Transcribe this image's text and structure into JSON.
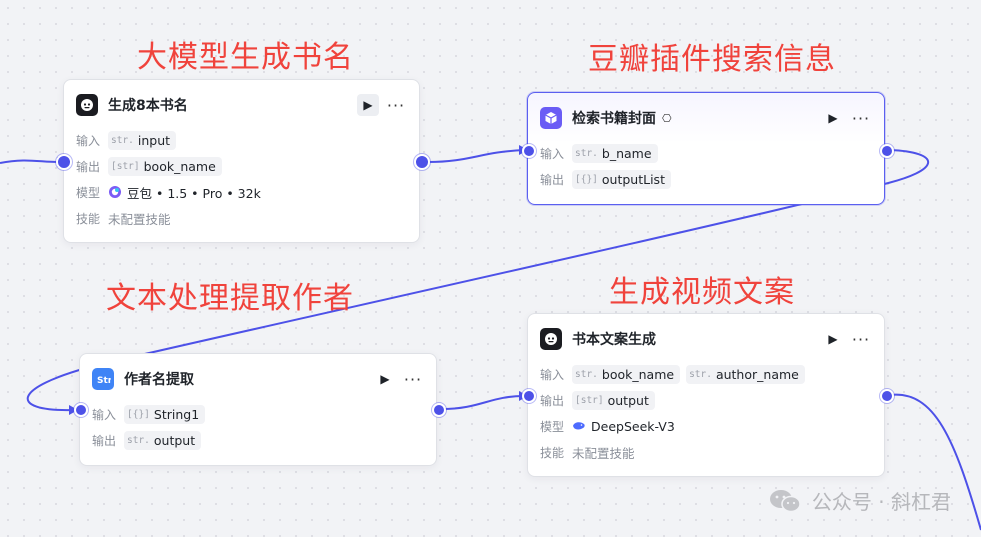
{
  "annotations": {
    "generate_titles": "大模型生成书名",
    "douban_search": "豆瓣插件搜索信息",
    "extract_author": "文本处理提取作者",
    "video_copy": "生成视频文案"
  },
  "labels": {
    "input": "输入",
    "output": "输出",
    "model": "模型",
    "skills": "技能"
  },
  "nodes": {
    "generate_books": {
      "title": "生成8本书名",
      "inputs": [
        {
          "type": "str.",
          "name": "input"
        }
      ],
      "outputs": [
        {
          "type": "[str]",
          "name": "book_name"
        }
      ],
      "model": "豆包 • 1.5 • Pro • 32k",
      "skills": "未配置技能"
    },
    "search_cover": {
      "title": "检索书籍封面",
      "inputs": [
        {
          "type": "str.",
          "name": "b_name"
        }
      ],
      "outputs": [
        {
          "type": "[{}]",
          "name": "outputList"
        }
      ]
    },
    "extract_author": {
      "title": "作者名提取",
      "inputs": [
        {
          "type": "[{}]",
          "name": "String1"
        }
      ],
      "outputs": [
        {
          "type": "str.",
          "name": "output"
        }
      ]
    },
    "book_copy": {
      "title": "书本文案生成",
      "inputs": [
        {
          "type": "str.",
          "name": "book_name"
        },
        {
          "type": "str.",
          "name": "author_name"
        }
      ],
      "outputs": [
        {
          "type": "[str]",
          "name": "output"
        }
      ],
      "model": "DeepSeek-V3",
      "skills": "未配置技能"
    }
  },
  "icons": {
    "llm": "llm-robot-icon",
    "plugin": "plugin-cube-icon",
    "text": "text-process-icon",
    "run": "play-icon",
    "more": "more-dots-icon"
  },
  "colors": {
    "edge": "#4d51e8",
    "annotation": "#f0433c",
    "selected_border": "#5b5ff0"
  },
  "watermark": "公众号 · 斜杠君"
}
